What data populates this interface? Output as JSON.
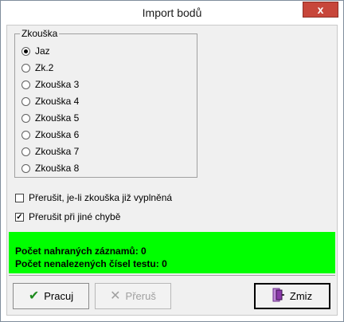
{
  "window": {
    "title": "Import bodů",
    "close_glyph": "x"
  },
  "group": {
    "legend": "Zkouška",
    "options": [
      {
        "label": "Jaz",
        "checked": true
      },
      {
        "label": "Zk.2",
        "checked": false
      },
      {
        "label": "Zkouška 3",
        "checked": false
      },
      {
        "label": "Zkouška 4",
        "checked": false
      },
      {
        "label": "Zkouška 5",
        "checked": false
      },
      {
        "label": "Zkouška 6",
        "checked": false
      },
      {
        "label": "Zkouška 7",
        "checked": false
      },
      {
        "label": "Zkouška 8",
        "checked": false
      }
    ]
  },
  "checkboxes": [
    {
      "label": "Přerušit, je-li zkouška již vyplněná",
      "checked": false
    },
    {
      "label": "Přerušit při jiné chybě",
      "checked": true
    }
  ],
  "status": {
    "line1": "Počet nahraných záznamů: 0",
    "line2": "Počet nenalezených čísel testu: 0",
    "color": "#00ff00"
  },
  "buttons": {
    "pracuj": {
      "label": "Pracuj",
      "icon": "checkmark-icon"
    },
    "prerus": {
      "label": "Přeruš",
      "icon": "cancel-x-icon"
    },
    "zmiz": {
      "label": "Zmiz",
      "icon": "exit-door-icon"
    }
  }
}
